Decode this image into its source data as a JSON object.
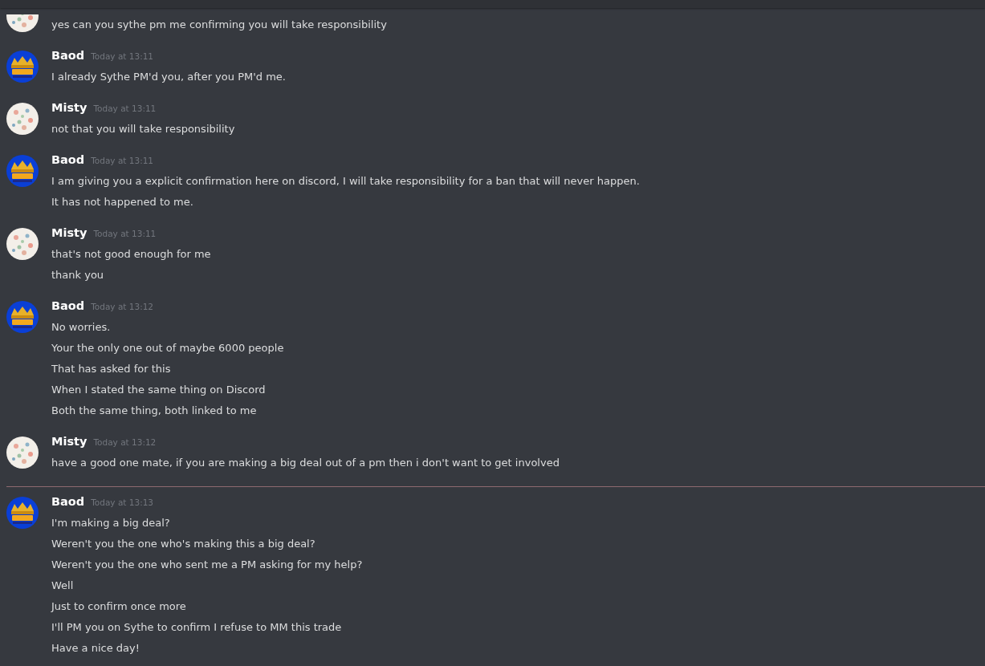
{
  "messages": [
    {
      "kind": "floral",
      "new_divider": false,
      "lines": [
        "yes can you sythe pm me confirming you will take responsibility"
      ]
    },
    {
      "author": "Baod",
      "time": "Today at 13:11",
      "kind": "crown",
      "new_divider": false,
      "lines": [
        "I already Sythe PM'd you, after you PM'd me."
      ]
    },
    {
      "author": "Misty",
      "time": "Today at 13:11",
      "kind": "floral",
      "new_divider": false,
      "lines": [
        "not that you will take responsibility"
      ]
    },
    {
      "author": "Baod",
      "time": "Today at 13:11",
      "kind": "crown",
      "new_divider": false,
      "lines": [
        "I am giving you a explicit confirmation here on discord, I will take responsibility for a ban that will never happen.",
        "It has not happened to me."
      ]
    },
    {
      "author": "Misty",
      "time": "Today at 13:11",
      "kind": "floral",
      "new_divider": false,
      "lines": [
        "that's not good enough for me",
        "thank you"
      ]
    },
    {
      "author": "Baod",
      "time": "Today at 13:12",
      "kind": "crown",
      "new_divider": false,
      "lines": [
        "No worries.",
        "Your the only one out of maybe 6000 people",
        "That has asked for this",
        "When I stated the same thing on Discord",
        "Both the same thing, both linked to me"
      ]
    },
    {
      "author": "Misty",
      "time": "Today at 13:12",
      "kind": "floral",
      "new_divider": false,
      "lines": [
        "have a good one mate, if you are making a big deal out of a pm then i don't want to get involved"
      ]
    },
    {
      "author": "Baod",
      "time": "Today at 13:13",
      "kind": "crown",
      "new_divider": true,
      "lines": [
        "I'm making a big deal?",
        "Weren't you the one who's making this a big deal?",
        "Weren't you the one who sent me a PM asking for my help?",
        "Well",
        "Just to confirm once more",
        "I'll PM you on Sythe to confirm I refuse to MM this trade",
        "Have a nice day!"
      ]
    }
  ]
}
